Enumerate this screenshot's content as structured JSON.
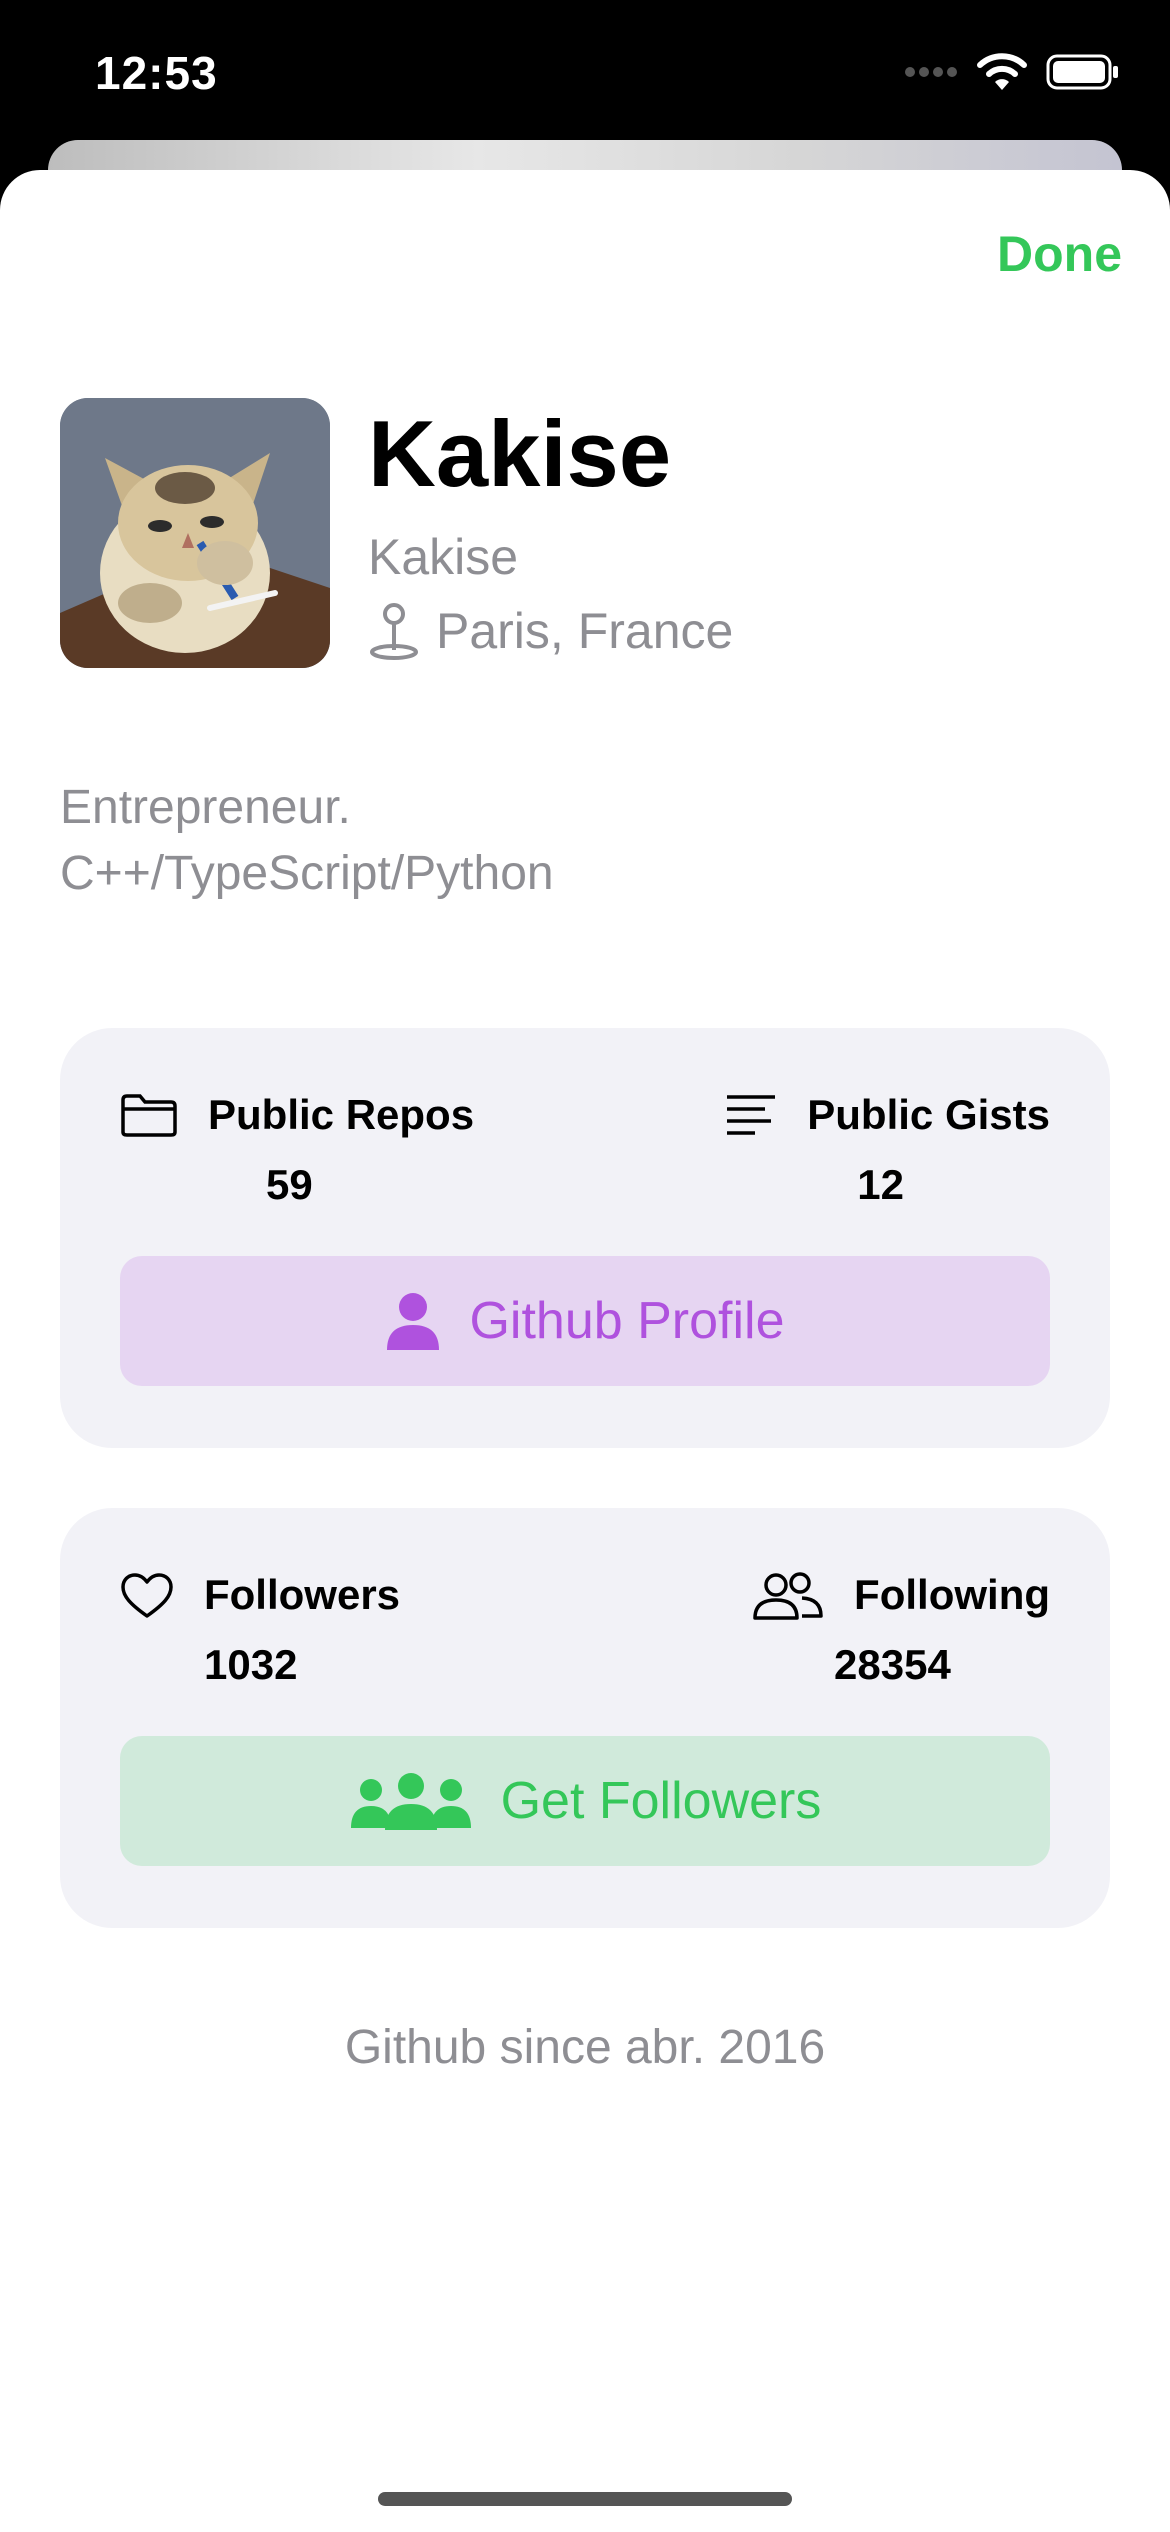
{
  "status_bar": {
    "time": "12:53"
  },
  "sheet": {
    "done_label": "Done"
  },
  "profile": {
    "name": "Kakise",
    "username": "Kakise",
    "location": "Paris, France",
    "bio_lines": [
      "Entrepreneur.",
      "C++/TypeScript/Python"
    ]
  },
  "repos_card": {
    "public_repos_label": "Public Repos",
    "public_repos_value": "59",
    "public_gists_label": "Public Gists",
    "public_gists_value": "12",
    "button_label": "Github Profile",
    "button_color": "#af52de"
  },
  "followers_card": {
    "followers_label": "Followers",
    "followers_value": "1032",
    "following_label": "Following",
    "following_value": "28354",
    "button_label": "Get Followers",
    "button_color": "#34c759"
  },
  "footer": {
    "since_text": "Github since abr. 2016"
  },
  "icons": {
    "location": "location-pin-icon",
    "repos": "folder-icon",
    "gists": "text-lines-icon",
    "github_profile": "person-icon",
    "followers": "heart-icon",
    "following": "two-persons-icon",
    "get_followers": "group-icon"
  }
}
